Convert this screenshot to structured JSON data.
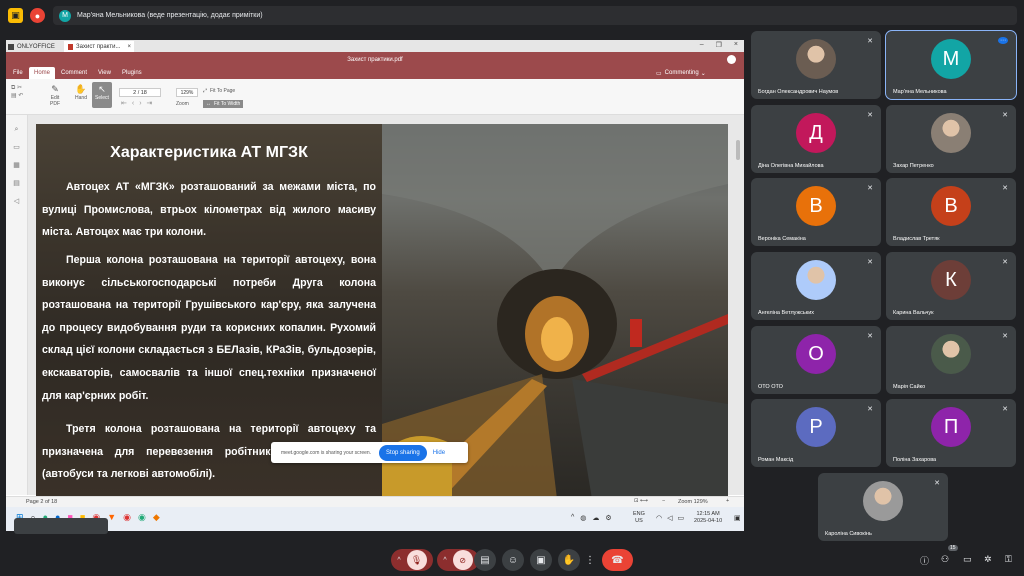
{
  "meet": {
    "presenter_name": "Мар'яна Мельникова (веде презентацію, додає примітки)",
    "presenter_initial": "М",
    "share_banner_text": "meet.google.com is sharing your screen.",
    "stop_sharing_label": "Stop sharing",
    "hide_label": "Hide",
    "participant_count_badge": "15"
  },
  "app": {
    "tab_app_label": "ONLYOFFICE",
    "tab_doc_label": "Захист практи...",
    "window_title": "Захист практики.pdf",
    "menu": [
      "File",
      "Home",
      "Comment",
      "View",
      "Plugins"
    ],
    "active_menu": "Home",
    "commenting_label": "Commenting",
    "toolbar": {
      "edit_pdf": "Edit PDF",
      "hand": "Hand",
      "select": "Select",
      "page_value": "2 / 18",
      "zoom_value": "129%",
      "zoom_label": "Zoom",
      "fit_page": "Fit To Page",
      "fit_width": "Fit To Width"
    },
    "status_page": "Page 2 of 18",
    "status_zoom": "Zoom 129%"
  },
  "slide": {
    "title": "Характеристика АТ МГЗК",
    "paragraphs": [
      "Автоцех АТ «МГЗК» розташований за межами міста, по вулиці Промислова, втрьох кілометрах від жилого масиву міста. Автоцех має три колони.",
      "Перша колона розташована на території автоцеху, вона виконує сільськогосподарські потреби Друга колона розташована на території Грушівського кар'єру, яка залучена до процесу видобування руди та корисних копалин. Рухомий склад цієї колони складається з БЕЛазів, КРаЗів, бульдозерів, екскаваторів, самосвалів та іншої спец.техніки призначеної для кар'єрних робіт.",
      "Третя колона розташована на території автоцеху та призначена для перевезення робітників та службовців (автобуси та легкові автомобілі)."
    ]
  },
  "taskbar": {
    "lang_top": "ENG",
    "lang_bottom": "US",
    "time": "12:15 AM",
    "date": "2025-04-10"
  },
  "participants": [
    {
      "name": "Богдан Олександрович Наумов",
      "initial": "",
      "color": "#6b5d52",
      "photo": true
    },
    {
      "name": "Мар'яна Мельникова",
      "initial": "М",
      "color": "#12a5a5",
      "photo": false
    },
    {
      "name": "Діна Олегівна Михайлова",
      "initial": "Д",
      "color": "#c2185b",
      "photo": false
    },
    {
      "name": "Захар Петренко",
      "initial": "",
      "color": "#8a7f74",
      "photo": true
    },
    {
      "name": "Вероніка Семакіна",
      "initial": "В",
      "color": "#e8710a",
      "photo": false
    },
    {
      "name": "Владислав Третяк",
      "initial": "В",
      "color": "#c5401a",
      "photo": false
    },
    {
      "name": "Ангеліна Ветлужських",
      "initial": "",
      "color": "#aecbfa",
      "photo": true
    },
    {
      "name": "Карина Вальчук",
      "initial": "К",
      "color": "#6d3e38",
      "photo": false
    },
    {
      "name": "ОТО ОТО",
      "initial": "О",
      "color": "#8e24aa",
      "photo": false
    },
    {
      "name": "Марія Сайко",
      "initial": "",
      "color": "#4a5a4a",
      "photo": true
    },
    {
      "name": "Роман Максід",
      "initial": "Р",
      "color": "#5c6bc0",
      "photo": false
    },
    {
      "name": "Поліна Захарова",
      "initial": "П",
      "color": "#8e24aa",
      "photo": false
    },
    {
      "name": "Кароліна Сивокінь",
      "initial": "",
      "color": "#9a9a9a",
      "photo": true
    }
  ],
  "icons": {
    "mic_off": "mic-off-icon",
    "end_call": "hangup-icon"
  },
  "colors": {
    "onlyoffice_header": "#9c4a4c",
    "meet_bg": "#202124",
    "tile_bg": "#3c4043",
    "stop_sharing": "#1a73e8",
    "end_call": "#ea4335"
  }
}
